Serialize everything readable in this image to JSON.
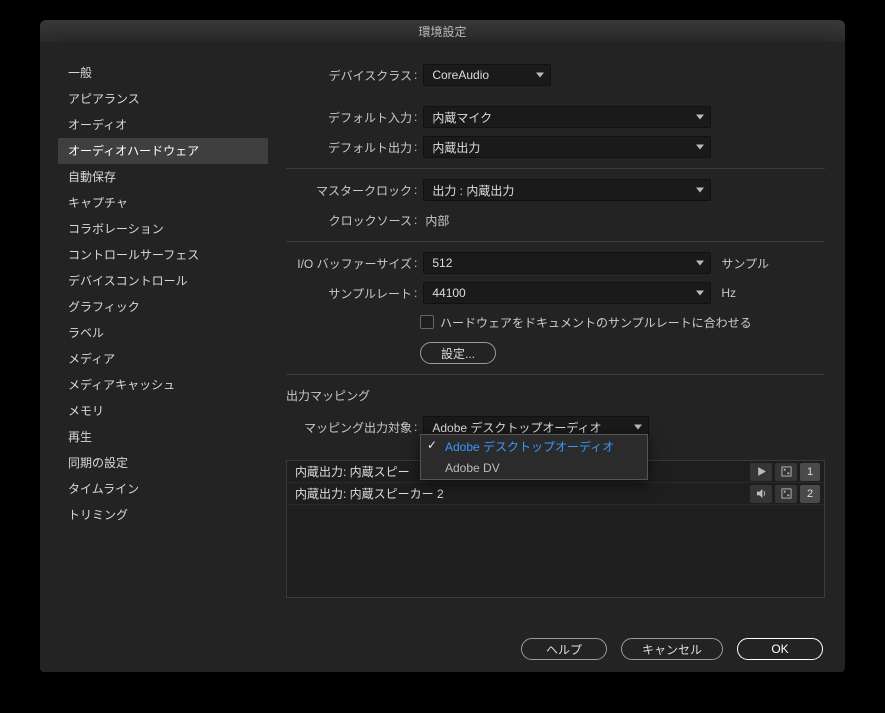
{
  "window": {
    "title": "環境設定"
  },
  "sidebar": {
    "items": [
      {
        "label": "一般"
      },
      {
        "label": "アピアランス"
      },
      {
        "label": "オーディオ"
      },
      {
        "label": "オーディオハードウェア",
        "selected": true
      },
      {
        "label": "自動保存"
      },
      {
        "label": "キャプチャ"
      },
      {
        "label": "コラボレーション"
      },
      {
        "label": "コントロールサーフェス"
      },
      {
        "label": "デバイスコントロール"
      },
      {
        "label": "グラフィック"
      },
      {
        "label": "ラベル"
      },
      {
        "label": "メディア"
      },
      {
        "label": "メディアキャッシュ"
      },
      {
        "label": "メモリ"
      },
      {
        "label": "再生"
      },
      {
        "label": "同期の設定"
      },
      {
        "label": "タイムライン"
      },
      {
        "label": "トリミング"
      }
    ]
  },
  "labels": {
    "device_class": "デバイスクラス",
    "default_input": "デフォルト入力",
    "default_output": "デフォルト出力",
    "master_clock": "マスタークロック",
    "clock_source": "クロックソース",
    "io_buffer": "I/O バッファーサイズ",
    "sample_rate": "サンプルレート",
    "match_hw": "ハードウェアをドキュメントのサンプルレートに合わせる",
    "settings_btn": "設定...",
    "output_mapping": "出力マッピング",
    "map_output": "マッピング出力対象",
    "colon": " :"
  },
  "values": {
    "device_class": "CoreAudio",
    "default_input": "内蔵マイク",
    "default_output": "内蔵出力",
    "master_clock": "出力 : 内蔵出力",
    "clock_source": "内部",
    "io_buffer": "512",
    "io_buffer_suffix": "サンプル",
    "sample_rate": "44100",
    "sample_rate_suffix": "Hz",
    "map_output": "Adobe デスクトップオーディオ"
  },
  "dropdown": {
    "items": [
      {
        "label": "Adobe デスクトップオーディオ",
        "selected": true
      },
      {
        "label": "Adobe DV"
      }
    ]
  },
  "outputs": [
    {
      "label": "内蔵出力: 内蔵スピー",
      "index": "1",
      "icon": "play"
    },
    {
      "label": "内蔵出力: 内蔵スピーカー 2",
      "index": "2",
      "icon": "speaker"
    }
  ],
  "footer": {
    "help": "ヘルプ",
    "cancel": "キャンセル",
    "ok": "OK"
  }
}
